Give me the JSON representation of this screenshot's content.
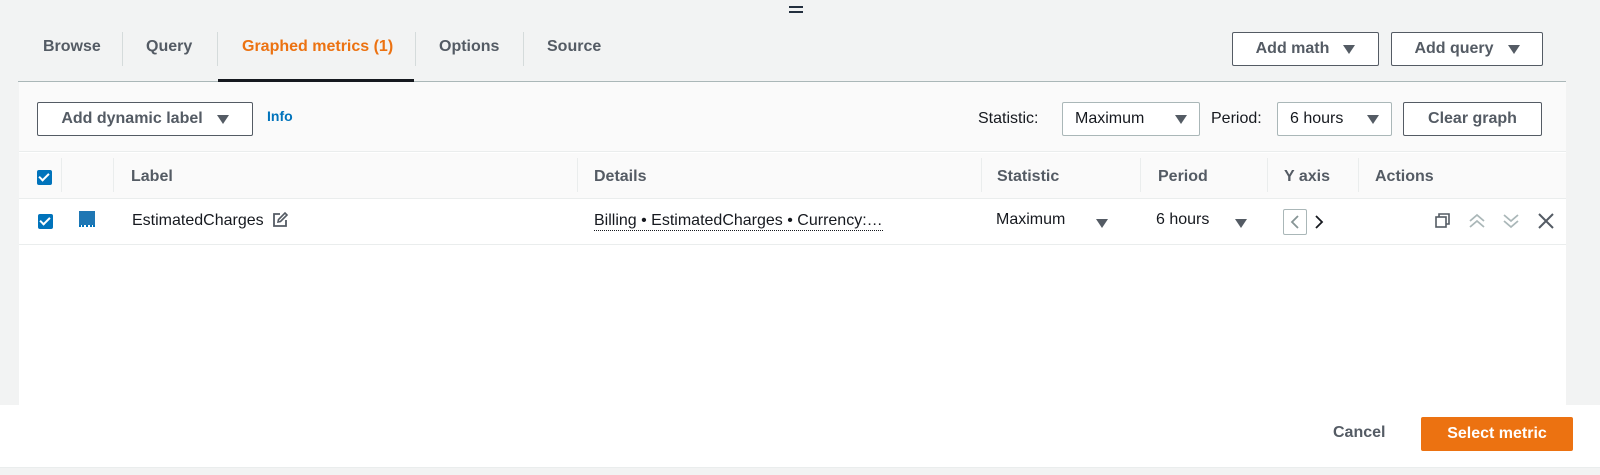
{
  "tabs": [
    {
      "label": "Browse"
    },
    {
      "label": "Query"
    },
    {
      "label": "Graphed metrics (1)"
    },
    {
      "label": "Options"
    },
    {
      "label": "Source"
    }
  ],
  "header_buttons": {
    "add_math": "Add math",
    "add_query": "Add query"
  },
  "toolbar": {
    "add_dynamic_label": "Add dynamic label",
    "info": "Info",
    "statistic_label": "Statistic:",
    "statistic_value": "Maximum",
    "period_label": "Period:",
    "period_value": "6 hours",
    "clear_graph": "Clear graph"
  },
  "table": {
    "columns": [
      "Label",
      "Details",
      "Statistic",
      "Period",
      "Y axis",
      "Actions"
    ],
    "rows": [
      {
        "color": "#1f77b4",
        "label": "EstimatedCharges",
        "details": "Billing • EstimatedCharges • Currency:…",
        "statistic": "Maximum",
        "period": "6 hours"
      }
    ]
  },
  "footer": {
    "cancel": "Cancel",
    "select_metric": "Select metric"
  },
  "colors": {
    "accent": "#ec7211",
    "link": "#0073bb",
    "series_color": "#1f77b4"
  }
}
